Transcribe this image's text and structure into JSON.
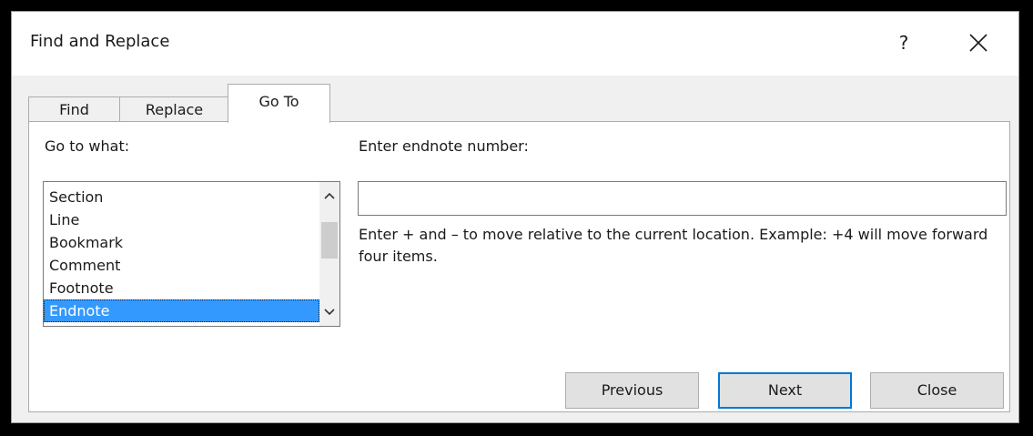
{
  "window": {
    "title": "Find and Replace",
    "help_label": "?",
    "close_icon": "close-icon"
  },
  "tabs": [
    {
      "label": "Find",
      "selected": false
    },
    {
      "label": "Replace",
      "selected": false
    },
    {
      "label": "Go To",
      "selected": true
    }
  ],
  "goto_what": {
    "label": "Go to what:",
    "items": [
      "Section",
      "Line",
      "Bookmark",
      "Comment",
      "Footnote",
      "Endnote"
    ],
    "selected": "Endnote"
  },
  "entry": {
    "label": "Enter endnote number:",
    "value": "",
    "hint": "Enter + and – to move relative to the current location. Example: +4 will move forward four items."
  },
  "buttons": {
    "previous": "Previous",
    "next": "Next",
    "close": "Close"
  },
  "colors": {
    "selection": "#3399ff",
    "default_button_border": "#0078d7"
  }
}
